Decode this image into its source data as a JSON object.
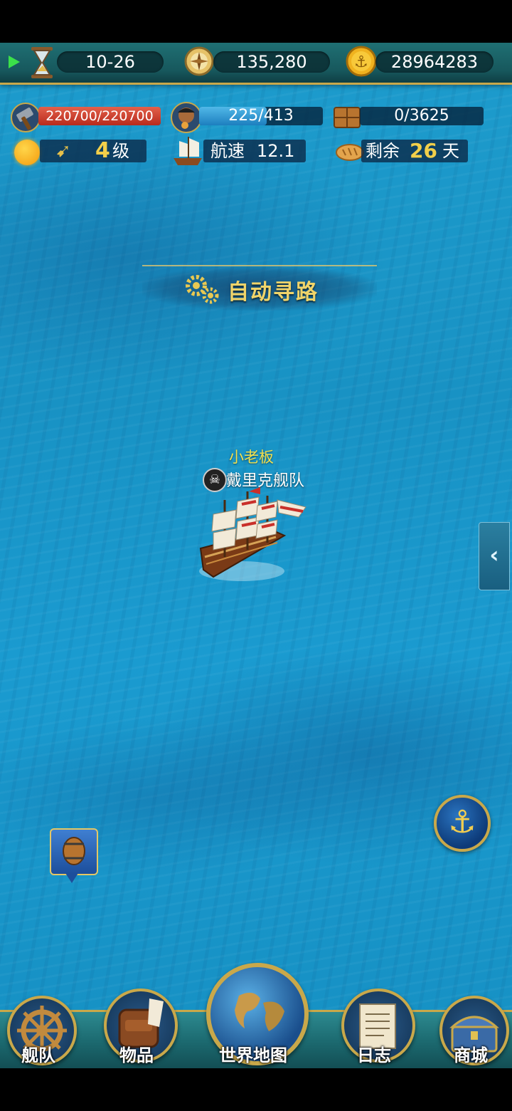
{
  "top_bar": {
    "date": "10-26",
    "compass_value": "135,280",
    "gold": "28964283"
  },
  "stats": {
    "durability": {
      "text": "220700/220700",
      "fraction": 1.0
    },
    "crew": {
      "current": "225",
      "sep": "/413",
      "fraction": 0.545
    },
    "cargo": "0/3625",
    "level_num": "4",
    "level_unit": "级",
    "speed_label": "航速",
    "speed_value": "12.1",
    "remain_label": "剩余",
    "remain_days": "26",
    "remain_unit": "天"
  },
  "auto_path": {
    "label": "自动寻路"
  },
  "ship": {
    "owner": "小老板",
    "fleet": "戴里克舰队"
  },
  "side_tab": {
    "glyph": "‹"
  },
  "bottom_nav": {
    "fleet": "舰队",
    "items": "物品",
    "world_map": "世界地图",
    "log": "日志",
    "shop": "商城"
  },
  "colors": {
    "sea": "#1a96c8",
    "gold_accent": "#c9a84a",
    "bar_teal": "#1f6f73"
  }
}
